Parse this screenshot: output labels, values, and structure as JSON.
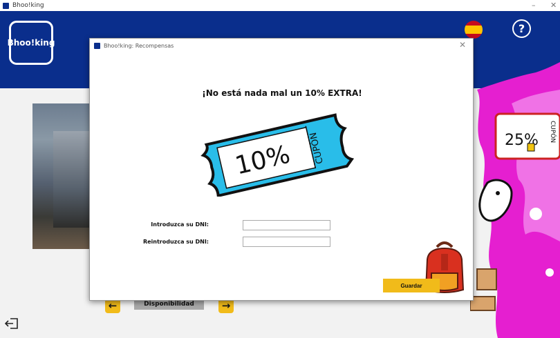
{
  "window": {
    "title": "Bhoo!king",
    "minimize": "–",
    "close": "✕"
  },
  "header": {
    "logo_text": "Bhoo!king",
    "help_label": "?"
  },
  "main": {
    "availability_label": "Disponibilidad",
    "prev_arrow": "←",
    "next_arrow": "→"
  },
  "decoration": {
    "coupon_text": "25%",
    "coupon_side": "CUPÓN"
  },
  "modal": {
    "title": "Bhoo!king: Recompensas",
    "close": "✕",
    "headline": "¡No está nada mal un 10% EXTRA!",
    "ticket_value": "10%",
    "ticket_side": "CUPÓN",
    "dni_label": "Introduzca su DNI:",
    "dni_value": "",
    "dni_repeat_label": "Reintroduzca su DNI:",
    "dni_repeat_value": "",
    "save_label": "Guardar"
  },
  "colors": {
    "brand_blue": "#0a2e8c",
    "accent_yellow": "#f1bb1a",
    "ticket_blue": "#29bde9"
  }
}
